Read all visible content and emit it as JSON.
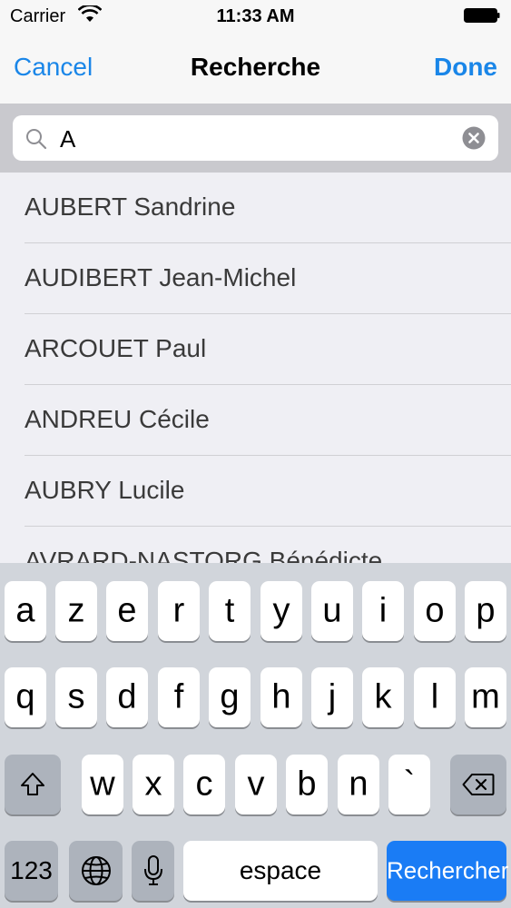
{
  "status": {
    "carrier": "Carrier",
    "time": "11:33 AM"
  },
  "nav": {
    "cancel": "Cancel",
    "title": "Recherche",
    "done": "Done"
  },
  "search": {
    "value": "A"
  },
  "results": [
    "AUBERT Sandrine",
    "AUDIBERT Jean-Michel",
    "ARCOUET Paul",
    "ANDREU Cécile",
    "AUBRY Lucile",
    "AVRARD-NASTORG Bénédicte"
  ],
  "keyboard": {
    "row1": [
      "a",
      "z",
      "e",
      "r",
      "t",
      "y",
      "u",
      "i",
      "o",
      "p"
    ],
    "row2": [
      "q",
      "s",
      "d",
      "f",
      "g",
      "h",
      "j",
      "k",
      "l",
      "m"
    ],
    "row3": [
      "w",
      "x",
      "c",
      "v",
      "b",
      "n",
      "`"
    ],
    "numbers": "123",
    "space": "espace",
    "search": "Rechercher"
  },
  "colors": {
    "accent": "#1a86e8",
    "search_key": "#1a7cf5"
  }
}
